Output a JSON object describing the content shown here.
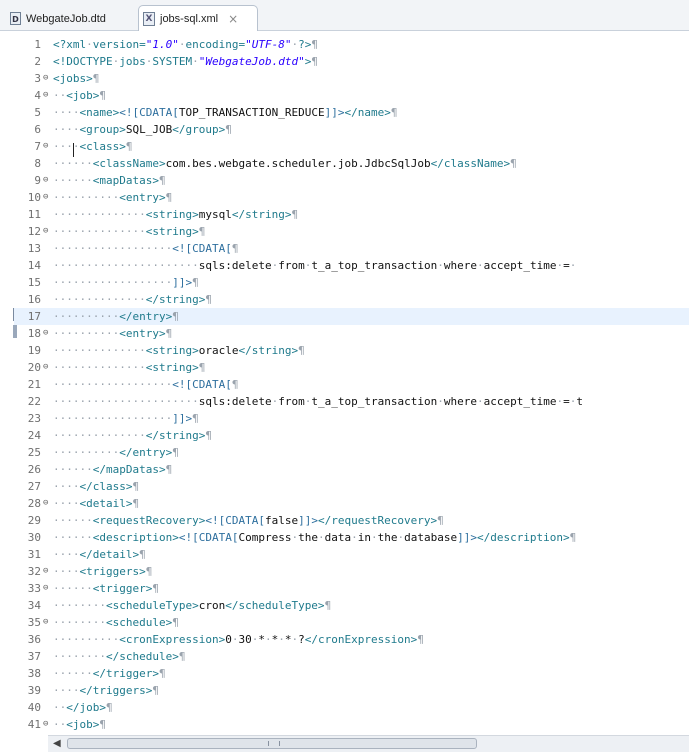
{
  "tabs": [
    {
      "label": "WebgateJob.dtd",
      "icon": "D",
      "active": false
    },
    {
      "label": "jobs-sql.xml",
      "icon": "X",
      "active": true,
      "close": "×"
    }
  ],
  "editor": {
    "current_line": 17,
    "lines": [
      {
        "n": "1",
        "fold": "",
        "t": "<?xml·version=\"1.0\"·encoding=\"UTF-8\"·?>¶"
      },
      {
        "n": "2",
        "fold": "",
        "t": "<!DOCTYPE·jobs·SYSTEM·\"WebgateJob.dtd\">¶"
      },
      {
        "n": "3",
        "fold": "⊖",
        "t": "<jobs>¶"
      },
      {
        "n": "4",
        "fold": "⊖",
        "t": "··<job>¶"
      },
      {
        "n": "5",
        "fold": "",
        "t": "····<name><![CDATA[TOP_TRANSACTION_REDUCE]]></name>¶"
      },
      {
        "n": "6",
        "fold": "",
        "t": "····<group>SQL_JOB</group>¶"
      },
      {
        "n": "7",
        "fold": "⊖",
        "t": "····<class>¶"
      },
      {
        "n": "8",
        "fold": "",
        "t": "······<className>com.bes.webgate.scheduler.job.JdbcSqlJob</className>¶"
      },
      {
        "n": "9",
        "fold": "⊖",
        "t": "······<mapDatas>¶"
      },
      {
        "n": "10",
        "fold": "⊖",
        "t": "··········<entry>¶"
      },
      {
        "n": "11",
        "fold": "",
        "t": "··············<string>mysql</string>¶"
      },
      {
        "n": "12",
        "fold": "⊖",
        "t": "··············<string>¶"
      },
      {
        "n": "13",
        "fold": "",
        "t": "··················<![CDATA[¶"
      },
      {
        "n": "14",
        "fold": "",
        "t": "······················sqls:delete·from·t_a_top_transaction·where·accept_time·=·"
      },
      {
        "n": "15",
        "fold": "",
        "t": "··················]]>¶"
      },
      {
        "n": "16",
        "fold": "",
        "t": "··············</string>¶"
      },
      {
        "n": "17",
        "fold": "",
        "t": "··········</entry>¶"
      },
      {
        "n": "18",
        "fold": "⊖",
        "t": "··········<entry>¶"
      },
      {
        "n": "19",
        "fold": "",
        "t": "··············<string>oracle</string>¶"
      },
      {
        "n": "20",
        "fold": "⊖",
        "t": "··············<string>¶"
      },
      {
        "n": "21",
        "fold": "",
        "t": "··················<![CDATA[¶"
      },
      {
        "n": "22",
        "fold": "",
        "t": "······················sqls:delete·from·t_a_top_transaction·where·accept_time·=·t"
      },
      {
        "n": "23",
        "fold": "",
        "t": "··················]]>¶"
      },
      {
        "n": "24",
        "fold": "",
        "t": "··············</string>¶"
      },
      {
        "n": "25",
        "fold": "",
        "t": "··········</entry>¶"
      },
      {
        "n": "26",
        "fold": "",
        "t": "······</mapDatas>¶"
      },
      {
        "n": "27",
        "fold": "",
        "t": "····</class>¶"
      },
      {
        "n": "28",
        "fold": "⊖",
        "t": "····<detail>¶"
      },
      {
        "n": "29",
        "fold": "",
        "t": "······<requestRecovery><![CDATA[false]]></requestRecovery>¶"
      },
      {
        "n": "30",
        "fold": "",
        "t": "······<description><![CDATA[Compress·the·data·in·the·database]]></description>¶"
      },
      {
        "n": "31",
        "fold": "",
        "t": "····</detail>¶"
      },
      {
        "n": "32",
        "fold": "⊖",
        "t": "····<triggers>¶"
      },
      {
        "n": "33",
        "fold": "⊖",
        "t": "······<trigger>¶"
      },
      {
        "n": "34",
        "fold": "",
        "t": "········<scheduleType>cron</scheduleType>¶"
      },
      {
        "n": "35",
        "fold": "⊖",
        "t": "········<schedule>¶"
      },
      {
        "n": "36",
        "fold": "",
        "t": "··········<cronExpression>0·30·*·*·*·?</cronExpression>¶"
      },
      {
        "n": "37",
        "fold": "",
        "t": "········</schedule>¶"
      },
      {
        "n": "38",
        "fold": "",
        "t": "······</trigger>¶"
      },
      {
        "n": "39",
        "fold": "",
        "t": "····</triggers>¶"
      },
      {
        "n": "40",
        "fold": "",
        "t": "··</job>¶"
      },
      {
        "n": "41",
        "fold": "⊖",
        "t": "··<job>¶"
      }
    ]
  },
  "scrollbar": {
    "left_arrow": "◀",
    "position": 0.0
  }
}
